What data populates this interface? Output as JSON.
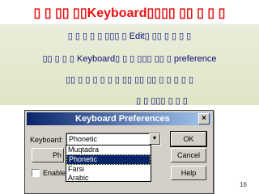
{
  "slide": {
    "title": "▯ ▯ ▯▯ ▯▯Keyboard▯▯▯▯ ▯▯ ▯ ▯ ▯",
    "line1": "▯ ▯ ▯ ▯ ▯ ▯▯▯ ▯ Edit▯ ▯▯ ▯ ▯ ▯ ▯",
    "line2": "▯▯ ▯ ▯ ▯ Keyboard▯ ▯ ▯ ▯▯▯ ▯▯ ▯ preference",
    "line3": "▯▯ ▯ ▯ ▯ ▯ ▯ ▯ ▯▯ ▯▯ ▯▯ ▯ ▯ ▯ ▯ ▯",
    "line4": "▯ ▯ ▯▯▯ ▯ ▯ ▯",
    "page_number": "16",
    "colors": {
      "title": "#e81010",
      "body": "#0a0a7a",
      "band": "#e2e8cc",
      "titlebar": "#0a246a"
    }
  },
  "dialog": {
    "title": "Keyboard Preferences",
    "close_glyph": "×",
    "keyboard_label": "Keyboard:",
    "selected_value": "Phonetic",
    "dropdown_glyph": "▼",
    "options": [
      "Muqtadra",
      "Phonetic",
      "Farsi",
      "Arabic"
    ],
    "selected_index": 1,
    "partial_button_label": "Ph",
    "enable_label": "Enable",
    "enable_checked": false,
    "buttons": {
      "ok": "OK",
      "cancel": "Cancel",
      "help": "Help"
    }
  }
}
